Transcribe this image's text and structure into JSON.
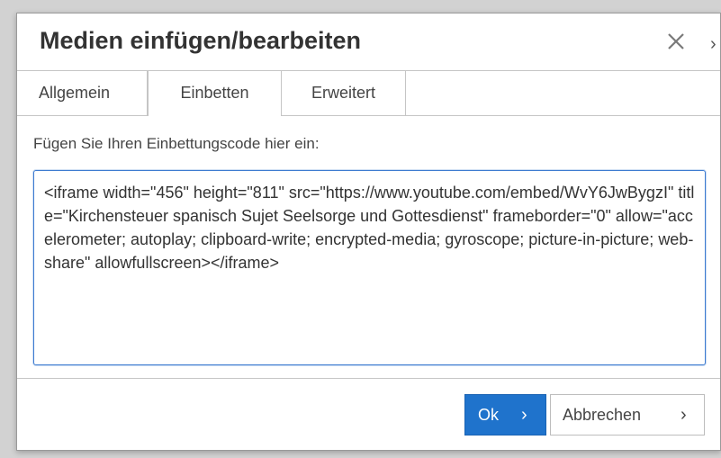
{
  "dialog": {
    "title": "Medien einfügen/bearbeiten",
    "close_icon": "close-icon",
    "overflow_glyph": "›"
  },
  "tabs": [
    {
      "label": "Allgemein"
    },
    {
      "label": "Einbetten"
    },
    {
      "label": "Erweitert"
    }
  ],
  "embed": {
    "label": "Fügen Sie Ihren Einbettungscode hier ein:",
    "code": "<iframe width=\"456\" height=\"811\" src=\"https://www.youtube.com/embed/WvY6JwBygzI\" title=\"Kirchensteuer spanisch Sujet Seelsorge und Gottesdienst\" frameborder=\"0\" allow=\"accelerometer; autoplay; clipboard-write; encrypted-media; gyroscope; picture-in-picture; web-share\" allowfullscreen></iframe>"
  },
  "footer": {
    "ok_label": "Ok",
    "ok_chevron": "›",
    "cancel_label": "Abbrechen",
    "cancel_chevron": "›"
  },
  "colors": {
    "primary": "#1f73cc",
    "focus": "#3d7bd0"
  }
}
